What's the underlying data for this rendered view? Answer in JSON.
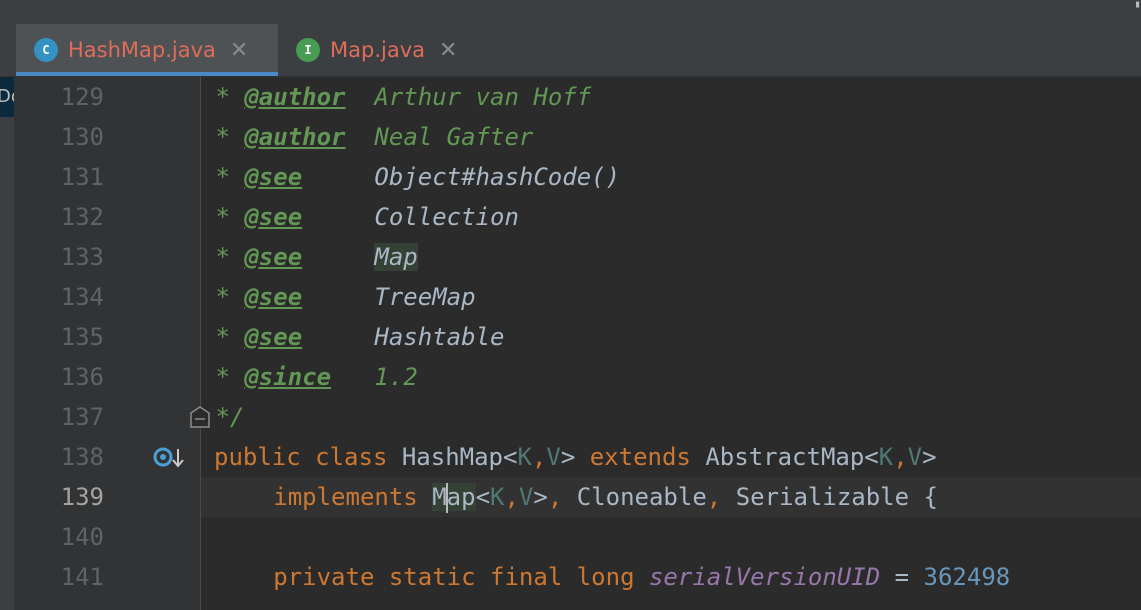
{
  "tabs": [
    {
      "label": "HashMap.java",
      "icon": "class-icon",
      "icon_glyph": "C",
      "close": "✕",
      "active": true
    },
    {
      "label": "Map.java",
      "icon": "interface-icon",
      "icon_glyph": "I",
      "close": "✕",
      "active": false
    }
  ],
  "left_strip": {
    "label": "Do"
  },
  "editor": {
    "current_line": 139,
    "lines": [
      {
        "num": "129"
      },
      {
        "num": "130"
      },
      {
        "num": "131"
      },
      {
        "num": "132"
      },
      {
        "num": "133"
      },
      {
        "num": "134"
      },
      {
        "num": "135"
      },
      {
        "num": "136"
      },
      {
        "num": "137"
      },
      {
        "num": "138"
      },
      {
        "num": "139"
      },
      {
        "num": "140"
      },
      {
        "num": "141"
      }
    ],
    "code": {
      "l129": {
        "star": " * ",
        "tag": "@author",
        "sp": "  ",
        "text": "Arthur van Hoff"
      },
      "l130": {
        "star": " * ",
        "tag": "@author",
        "sp": "  ",
        "text": "Neal Gafter"
      },
      "l131": {
        "star": " * ",
        "tag": "@see",
        "sp": "     ",
        "ref": "Object#hashCode()"
      },
      "l132": {
        "star": " * ",
        "tag": "@see",
        "sp": "     ",
        "ref": "Collection"
      },
      "l133": {
        "star": " * ",
        "tag": "@see",
        "sp": "     ",
        "ref": "Map"
      },
      "l134": {
        "star": " * ",
        "tag": "@see",
        "sp": "     ",
        "ref": "TreeMap"
      },
      "l135": {
        "star": " * ",
        "tag": "@see",
        "sp": "     ",
        "ref": "Hashtable"
      },
      "l136": {
        "star": " * ",
        "tag": "@since",
        "sp": "   ",
        "text": "1.2"
      },
      "l137": {
        "star": " */"
      },
      "l138": {
        "kw1": "public",
        "kw2": "class",
        "name": "HashMap",
        "lt": "<",
        "k": "K",
        "c": ",",
        "v": "V",
        "gt": ">",
        "kw3": "extends",
        "sup": "AbstractMap",
        "lt2": "<",
        "k2": "K",
        "c2": ",",
        "v2": "V",
        "gt2": ">"
      },
      "l139": {
        "kw": "implements",
        "m1": "M",
        "m2": "ap",
        "lt": "<",
        "k": "K",
        "c": ",",
        "v": "V",
        "gt": ">",
        "comma1": ",",
        "i2": "Cloneable",
        "comma2": ",",
        "i3": "Serializable",
        "brace": "{"
      },
      "l141": {
        "kw1": "private",
        "kw2": "static",
        "kw3": "final",
        "kw4": "long",
        "field": "serialVersionUID",
        "eq": "=",
        "num": "362498"
      }
    }
  }
}
